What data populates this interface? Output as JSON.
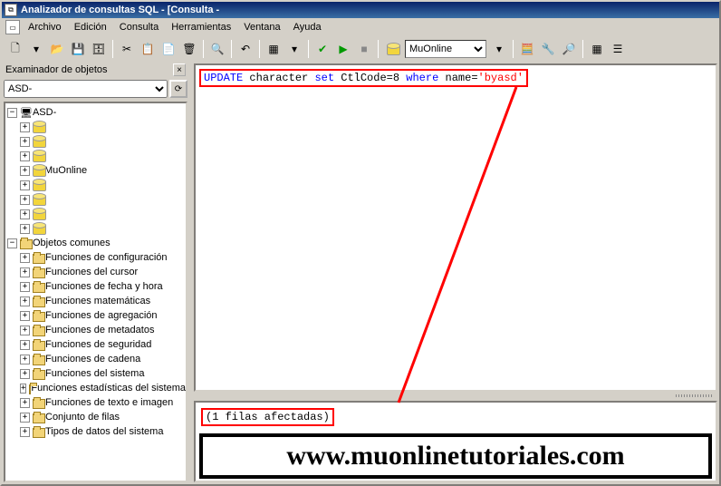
{
  "title": "Analizador de consultas SQL - [Consulta -",
  "menu": [
    "Archivo",
    "Edición",
    "Consulta",
    "Herramientas",
    "Ventana",
    "Ayuda"
  ],
  "db_selected": "MuOnline",
  "pane_label": "Examinador de objetos",
  "server_selected": "ASD-",
  "tree": {
    "root": "ASD-",
    "dbs": [
      "",
      "",
      "",
      "MuOnline",
      "",
      "",
      "",
      ""
    ],
    "common": "Objetos comunes",
    "folders": [
      "Funciones de configuración",
      "Funciones del cursor",
      "Funciones de fecha y hora",
      "Funciones matemáticas",
      "Funciones de agregación",
      "Funciones de metadatos",
      "Funciones de seguridad",
      "Funciones de cadena",
      "Funciones del sistema",
      "Funciones estadísticas del sistema",
      "Funciones de texto e imagen",
      "Conjunto de filas",
      "Tipos de datos del sistema"
    ]
  },
  "sql": {
    "k1": "UPDATE",
    "t1": "character",
    "k2": "set",
    "t2": "CtlCode",
    "eq": "=",
    "v": "8",
    "k3": "where",
    "t3": "name",
    "s": "'byasd'"
  },
  "result": "(1 filas afectadas)",
  "watermark": "www.muonlinetutoriales.com"
}
